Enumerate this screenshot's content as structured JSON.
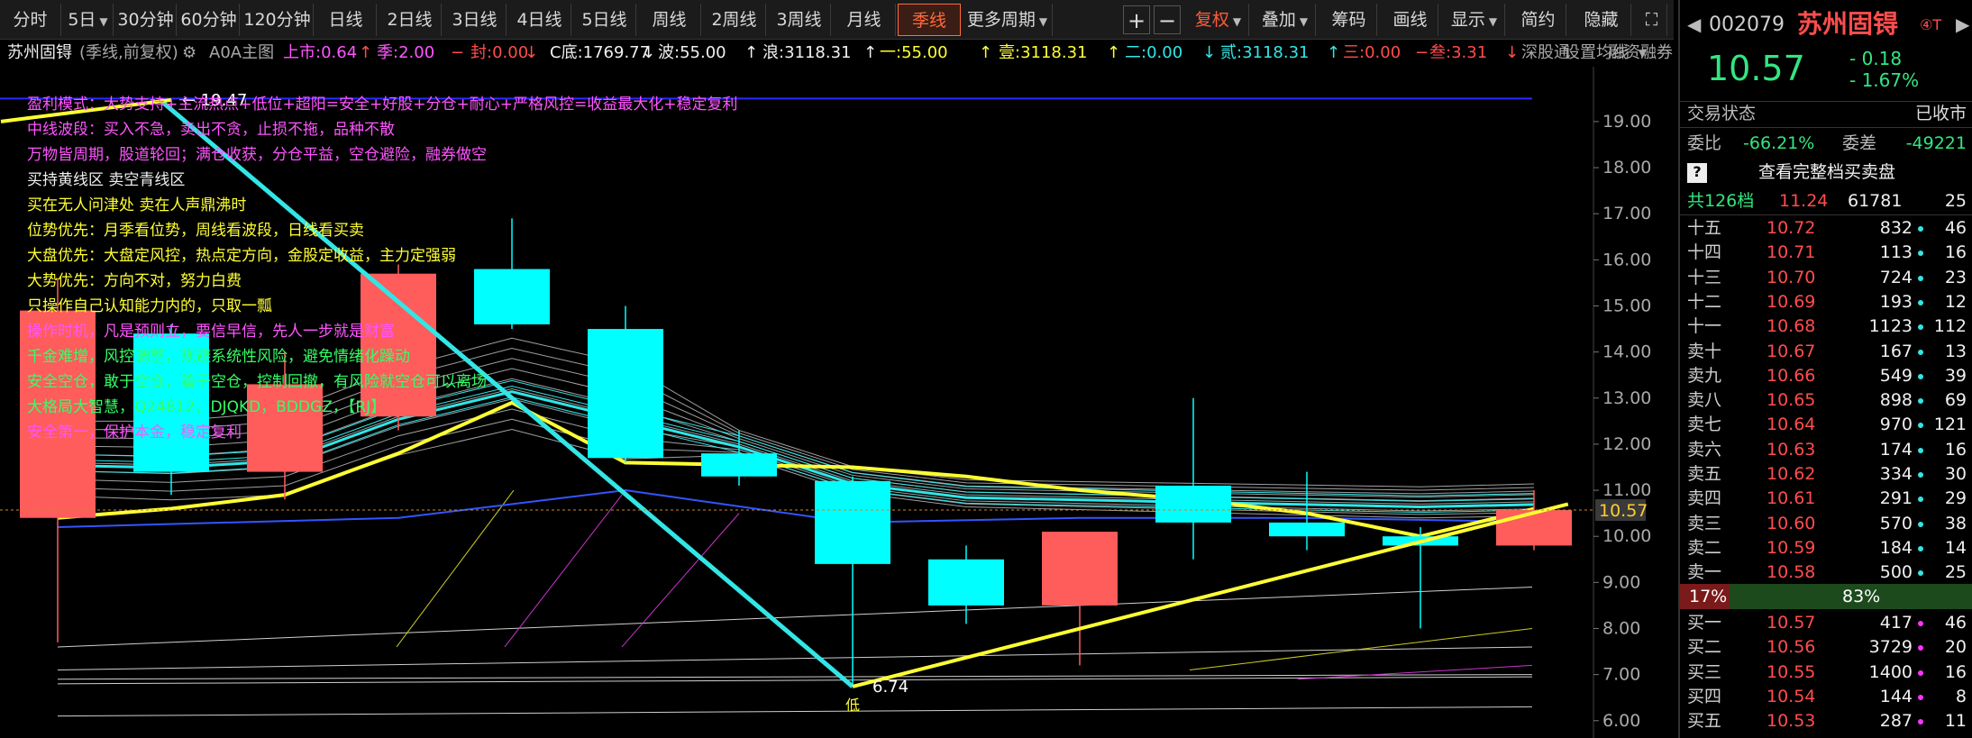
{
  "toolbar": {
    "buttons": [
      "分时",
      "5日",
      "30分钟",
      "60分钟",
      "120分钟",
      "日线",
      "2日线",
      "3日线",
      "4日线",
      "5日线",
      "周线",
      "2周线",
      "3周线",
      "月线",
      "季线",
      "更多周期"
    ],
    "plus": "+",
    "minus": "−",
    "fuquan": "复权",
    "diejia": "叠加",
    "choumaz": "筹码",
    "huaxian": "画线",
    "xianshi": "显示",
    "jianyue": "简约",
    "yincang": "隐藏",
    "expand": "⛶"
  },
  "infobar": {
    "name": "苏州固锝",
    "mode": "(季线,前复权)",
    "gear": "⚙",
    "main": "A0A主图",
    "items": [
      {
        "t": "上市:0.64",
        "c": "mag"
      },
      {
        "t": "↑",
        "c": "red"
      },
      {
        "t": "季:2.00",
        "c": "mag"
      },
      {
        "t": "−",
        "c": "red"
      },
      {
        "t": "封:0.00",
        "c": "red"
      },
      {
        "t": "↓",
        "c": "red"
      },
      {
        "t": "C底:1769.77",
        "c": "white"
      },
      {
        "t": "↓",
        "c": "white"
      },
      {
        "t": "波:55.00",
        "c": "white"
      },
      {
        "t": "↑",
        "c": "white"
      },
      {
        "t": "浪:3118.31",
        "c": "white"
      },
      {
        "t": "↑",
        "c": "white"
      },
      {
        "t": "一:55.00",
        "c": "yel"
      },
      {
        "t": "↑",
        "c": "yel"
      },
      {
        "t": "壹:3118.31",
        "c": "yel"
      },
      {
        "t": "↑",
        "c": "yel"
      },
      {
        "t": "二:0.00",
        "c": "cyan"
      },
      {
        "t": "↓",
        "c": "cyan"
      },
      {
        "t": "贰:3118.31",
        "c": "cyan"
      },
      {
        "t": "↑",
        "c": "cyan"
      },
      {
        "t": "三:0.00",
        "c": "red"
      },
      {
        "t": "−",
        "c": "red"
      },
      {
        "t": "叁:3.31",
        "c": "red"
      },
      {
        "t": "↓",
        "c": "red"
      }
    ],
    "shen": "深股通",
    "rongzi": "融资融券",
    "setting": "设置均线"
  },
  "annotations": [
    {
      "t": "盈利模式：大势支持+主流热点+低位+超阳=安全+好股+分仓+耐心+严格风控=收益最大化+稳定复利",
      "c": "mag"
    },
    {
      "t": "中线波段：买入不急，卖出不贪，止损不拖，品种不散",
      "c": "mag"
    },
    {
      "t": "万物皆周期，股道轮回；满仓收获，分仓平益，空仓避险，融券做空",
      "c": "mag"
    },
    {
      "t": "买持黄线区    卖空青线区",
      "c": "white"
    },
    {
      "t": "买在无人问津处  卖在人声鼎沸时",
      "c": "yel"
    },
    {
      "t": "位势优先：月季看位势，周线看波段，日线看买卖",
      "c": "yel"
    },
    {
      "t": "大盘优先：大盘定风控，热点定方向，金股定收益，主力定强弱",
      "c": "yel"
    },
    {
      "t": "大势优先：方向不对，努力白费",
      "c": "yel"
    },
    {
      "t": "只操作自己认知能力内的，只取一瓢",
      "c": "yel"
    },
    {
      "t": "操作时机，凡是预则立，要信早信，先人一步就是财富",
      "c": "mag"
    },
    {
      "t": "千金难增，风控调整，规避系统性风险，避免情绪化躁动",
      "c": "grn"
    },
    {
      "t": "安全空仓，敢于空仓，善于空仓，控制回撤，有风险就空仓可以离场",
      "c": "grn"
    },
    {
      "t": "大格局大智慧，Q24812，DJQKD，BDDGZ，【RJ】",
      "c": "grn"
    },
    {
      "t": "安全第一，保护本金，稳定复利",
      "c": "mag"
    }
  ],
  "chart_data": {
    "type": "candlestick",
    "period": "季线",
    "high_label": "19.47",
    "low_label": "6.74",
    "low_tag": "低",
    "current_price": "10.57",
    "y_ticks": [
      "19.00",
      "18.00",
      "17.00",
      "16.00",
      "15.00",
      "14.00",
      "13.00",
      "12.00",
      "11.00",
      "10.00",
      "9.00",
      "8.00",
      "7.00",
      "6.00"
    ],
    "ylim": [
      5.8,
      19.8
    ],
    "candles": [
      {
        "o": 10.4,
        "c": 14.9,
        "h": 15.6,
        "l": 7.7,
        "up": true
      },
      {
        "o": 14.4,
        "c": 11.4,
        "h": 14.6,
        "l": 10.9,
        "up": false
      },
      {
        "o": 11.4,
        "c": 13.3,
        "h": 14.0,
        "l": 10.8,
        "up": true
      },
      {
        "o": 12.6,
        "c": 15.7,
        "h": 15.9,
        "l": 12.3,
        "up": true
      },
      {
        "o": 15.8,
        "c": 14.6,
        "h": 16.9,
        "l": 14.5,
        "up": false
      },
      {
        "o": 14.5,
        "c": 11.7,
        "h": 15.0,
        "l": 11.6,
        "up": false
      },
      {
        "o": 11.8,
        "c": 11.3,
        "h": 12.3,
        "l": 11.1,
        "up": false
      },
      {
        "o": 11.2,
        "c": 9.4,
        "h": 11.3,
        "l": 6.74,
        "up": false
      },
      {
        "o": 9.5,
        "c": 8.5,
        "h": 9.8,
        "l": 8.1,
        "up": false
      },
      {
        "o": 8.5,
        "c": 10.1,
        "h": 10.1,
        "l": 7.2,
        "up": true
      },
      {
        "o": 11.1,
        "c": 10.3,
        "h": 13.0,
        "l": 9.5,
        "up": false
      },
      {
        "o": 10.3,
        "c": 10.0,
        "h": 11.4,
        "l": 9.7,
        "up": false
      },
      {
        "o": 10.0,
        "c": 9.8,
        "h": 10.2,
        "l": 8.0,
        "up": false
      },
      {
        "o": 9.8,
        "c": 10.57,
        "h": 11.0,
        "l": 9.7,
        "up": true
      }
    ],
    "ma_yellow": [
      10.4,
      10.6,
      10.9,
      11.8,
      12.9,
      11.6,
      11.55,
      11.5,
      11.3,
      11.0,
      10.8,
      10.5,
      10.0,
      10.6
    ],
    "ma_white": [
      11.6,
      11.55,
      11.7,
      12.6,
      13.2,
      12.6,
      12.0,
      11.2,
      10.9,
      10.85,
      10.8,
      10.75,
      10.7,
      10.75
    ],
    "trend_cyan": [
      [
        0.9,
        19.47
      ],
      [
        7.0,
        6.74
      ]
    ],
    "trend_yellow_left": [
      [
        -0.5,
        19.0
      ],
      [
        1.0,
        19.47
      ]
    ],
    "trend_yellow_right": [
      [
        7.0,
        6.74
      ],
      [
        13.3,
        10.7
      ]
    ],
    "blue_line": 19.5
  },
  "right_panel": {
    "code": "002079",
    "name": "苏州固锝",
    "badge": "④T",
    "price": "10.57",
    "change": "- 0.18",
    "pct": "- 1.67%",
    "trade_state_label": "交易状态",
    "trade_state": "已收市",
    "weibi_label": "委比",
    "weibi": "-66.21%",
    "weicha_label": "委差",
    "weicha": "-49221",
    "view_full": "查看完整档买卖盘",
    "help": "?",
    "total_label": "共126档",
    "total_price": "11.24",
    "total_vol": "61781",
    "total_cnt": "25",
    "sell": [
      {
        "lbl": "十五",
        "px": "10.72",
        "vol": "832",
        "cnt": "46",
        "dot": "cyan"
      },
      {
        "lbl": "十四",
        "px": "10.71",
        "vol": "113",
        "cnt": "16",
        "dot": "cyan"
      },
      {
        "lbl": "十三",
        "px": "10.70",
        "vol": "724",
        "cnt": "23",
        "dot": "cyan"
      },
      {
        "lbl": "十二",
        "px": "10.69",
        "vol": "193",
        "cnt": "12",
        "dot": "cyan"
      },
      {
        "lbl": "十一",
        "px": "10.68",
        "vol": "1123",
        "cnt": "112",
        "dot": "cyan"
      },
      {
        "lbl": "卖十",
        "px": "10.67",
        "vol": "167",
        "cnt": "13",
        "dot": "cyan"
      },
      {
        "lbl": "卖九",
        "px": "10.66",
        "vol": "549",
        "cnt": "39",
        "dot": "cyan"
      },
      {
        "lbl": "卖八",
        "px": "10.65",
        "vol": "898",
        "cnt": "69",
        "dot": "cyan"
      },
      {
        "lbl": "卖七",
        "px": "10.64",
        "vol": "970",
        "cnt": "121",
        "dot": "cyan"
      },
      {
        "lbl": "卖六",
        "px": "10.63",
        "vol": "174",
        "cnt": "16",
        "dot": "cyan"
      },
      {
        "lbl": "卖五",
        "px": "10.62",
        "vol": "334",
        "cnt": "30",
        "dot": "cyan"
      },
      {
        "lbl": "卖四",
        "px": "10.61",
        "vol": "291",
        "cnt": "29",
        "dot": "cyan"
      },
      {
        "lbl": "卖三",
        "px": "10.60",
        "vol": "570",
        "cnt": "38",
        "dot": "cyan"
      },
      {
        "lbl": "卖二",
        "px": "10.59",
        "vol": "184",
        "cnt": "14",
        "dot": "cyan"
      },
      {
        "lbl": "卖一",
        "px": "10.58",
        "vol": "500",
        "cnt": "25",
        "dot": "cyan"
      }
    ],
    "ratio_left": "17%",
    "ratio_right": "83%",
    "ratio_left_value": 0.17,
    "buy": [
      {
        "lbl": "买一",
        "px": "10.57",
        "vol": "417",
        "cnt": "46",
        "dot": "mag"
      },
      {
        "lbl": "买二",
        "px": "10.56",
        "vol": "3729",
        "cnt": "20",
        "dot": "mag"
      },
      {
        "lbl": "买三",
        "px": "10.55",
        "vol": "1400",
        "cnt": "16",
        "dot": "mag"
      },
      {
        "lbl": "买四",
        "px": "10.54",
        "vol": "144",
        "cnt": "8",
        "dot": "mag"
      },
      {
        "lbl": "买五",
        "px": "10.53",
        "vol": "287",
        "cnt": "11",
        "dot": "mag"
      }
    ]
  }
}
